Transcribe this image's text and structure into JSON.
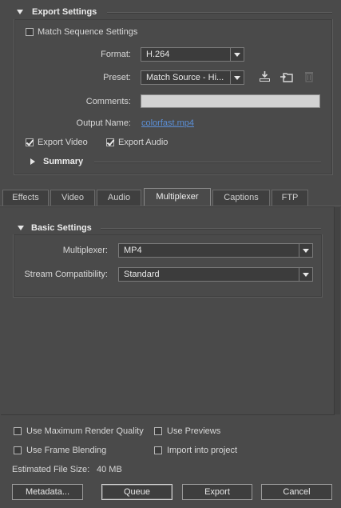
{
  "export_settings": {
    "title": "Export Settings",
    "match_sequence": {
      "label": "Match Sequence Settings",
      "checked": false
    },
    "format": {
      "label": "Format:",
      "value": "H.264"
    },
    "preset": {
      "label": "Preset:",
      "value": "Match Source - Hi..."
    },
    "preset_icons": [
      "save-preset-icon",
      "import-preset-icon",
      "delete-preset-icon"
    ],
    "comments": {
      "label": "Comments:",
      "value": ""
    },
    "output_name": {
      "label": "Output Name:",
      "value": "colorfast.mp4"
    },
    "export_video": {
      "label": "Export Video",
      "checked": true
    },
    "export_audio": {
      "label": "Export Audio",
      "checked": true
    },
    "summary": {
      "label": "Summary",
      "expanded": false
    }
  },
  "tabs": [
    {
      "label": "Effects",
      "active": false
    },
    {
      "label": "Video",
      "active": false
    },
    {
      "label": "Audio",
      "active": false
    },
    {
      "label": "Multiplexer",
      "active": true
    },
    {
      "label": "Captions",
      "active": false
    },
    {
      "label": "FTP",
      "active": false
    }
  ],
  "basic_settings": {
    "title": "Basic Settings",
    "multiplexer": {
      "label": "Multiplexer:",
      "value": "MP4"
    },
    "stream_compat": {
      "label": "Stream Compatibility:",
      "value": "Standard"
    }
  },
  "footer": {
    "max_render": {
      "label": "Use Maximum Render Quality",
      "checked": false
    },
    "use_previews": {
      "label": "Use Previews",
      "checked": false
    },
    "frame_blending": {
      "label": "Use Frame Blending",
      "checked": false
    },
    "import_project": {
      "label": "Import into project",
      "checked": false
    },
    "file_size": {
      "label": "Estimated File Size:",
      "value": "40 MB"
    },
    "buttons": {
      "metadata": "Metadata...",
      "queue": "Queue",
      "export": "Export",
      "cancel": "Cancel"
    }
  },
  "colors": {
    "background": "#4a4a4a",
    "link": "#5b8fd6",
    "text": "#dcdcdc"
  }
}
